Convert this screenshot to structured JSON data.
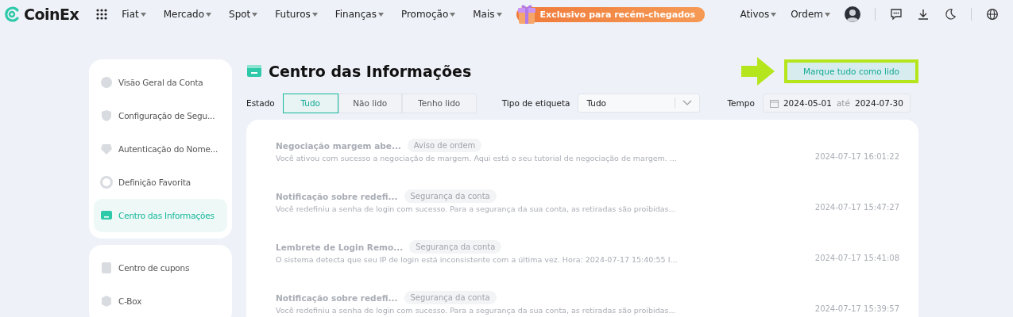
{
  "nav": {
    "logo": "CoinEx",
    "menu": [
      {
        "label": "Fiat"
      },
      {
        "label": "Mercado"
      },
      {
        "label": "Spot"
      },
      {
        "label": "Futuros"
      },
      {
        "label": "Finanças"
      },
      {
        "label": "Promoção"
      },
      {
        "label": "Mais"
      }
    ],
    "promo": "Exclusivo para recém-chegados",
    "right_menu": [
      {
        "label": "Ativos"
      },
      {
        "label": "Ordem"
      }
    ]
  },
  "sidebar": {
    "groups": [
      [
        {
          "label": "Visão Geral da Conta",
          "selected": false
        },
        {
          "label": "Configuração de Segu...",
          "selected": false
        },
        {
          "label": "Autenticação do Nome...",
          "selected": false
        },
        {
          "label": "Definição Favorita",
          "selected": false
        },
        {
          "label": "Centro das Informações",
          "selected": true
        }
      ],
      [
        {
          "label": "Centro de cupons",
          "selected": false
        },
        {
          "label": "C-Box",
          "selected": false
        }
      ]
    ]
  },
  "page": {
    "title": "Centro das Informações",
    "mark_all_button": "Marque tudo como lido",
    "highlighted": true
  },
  "filters": {
    "state_label": "Estado",
    "state_tabs": [
      {
        "label": "Tudo",
        "selected": true
      },
      {
        "label": "Não lido",
        "selected": false
      },
      {
        "label": "Tenho lido",
        "selected": false
      }
    ],
    "tag_label": "Tipo de etiqueta",
    "tag_value": "Tudo",
    "time_label": "Tempo",
    "date_from": "2024-05-01",
    "date_sep": "até",
    "date_to": "2024-07-30"
  },
  "messages": [
    {
      "title": "Negociação margem abe...",
      "tag": "Aviso de ordem",
      "text": "Você ativou com sucesso a negociação de margem. Aqui está o seu tutorial de negociação de margem. ...",
      "time": "2024-07-17 16:01:22"
    },
    {
      "title": "Notificação sobre redefi...",
      "tag": "Segurança da conta",
      "text": "Você redefiniu a senha de login com sucesso. Para a segurança da sua conta, as retiradas são proibidas...",
      "time": "2024-07-17 15:47:27"
    },
    {
      "title": "Lembrete de Login Remo...",
      "tag": "Segurança da conta",
      "text": "O sistema detecta que seu IP de login está inconsistente com a última vez. Hora:  2024-07-17 15:40:55 I...",
      "time": "2024-07-17 15:41:08"
    },
    {
      "title": "Notificação sobre redefi...",
      "tag": "Segurança da conta",
      "text": "Você redefiniu a senha de login com sucesso. Para a segurança da sua conta, as retiradas são proibidas...",
      "time": "2024-07-17 15:39:57"
    }
  ]
}
